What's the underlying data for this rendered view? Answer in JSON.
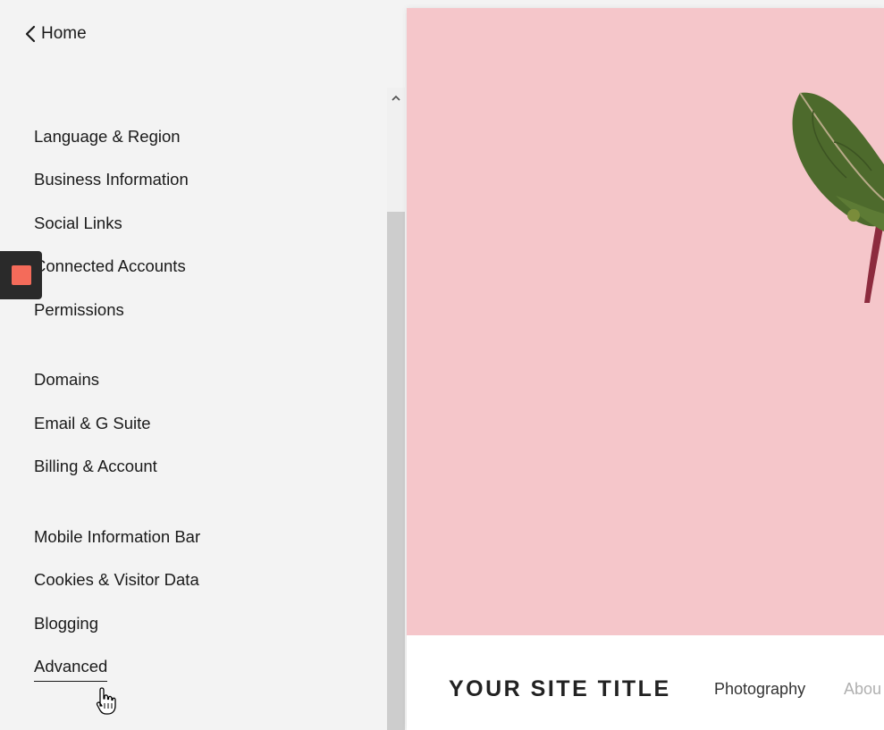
{
  "sidebar": {
    "home_label": "Home",
    "groups": [
      {
        "items": [
          {
            "label": "Language & Region"
          },
          {
            "label": "Business Information"
          },
          {
            "label": "Social Links"
          },
          {
            "label": "Connected Accounts"
          },
          {
            "label": "Permissions"
          }
        ]
      },
      {
        "items": [
          {
            "label": "Domains"
          },
          {
            "label": "Email & G Suite"
          },
          {
            "label": "Billing & Account"
          }
        ]
      },
      {
        "items": [
          {
            "label": "Mobile Information Bar"
          },
          {
            "label": "Cookies & Visitor Data"
          },
          {
            "label": "Blogging"
          },
          {
            "label": "Advanced"
          }
        ]
      }
    ],
    "hovered_item": "Advanced"
  },
  "badge": {
    "icon": "record-square-icon",
    "color": "#f46b5a"
  },
  "preview": {
    "hero_color": "#f5c6ca",
    "site_title": "YOUR SITE TITLE",
    "nav": [
      {
        "label": "Photography",
        "color": "#333333"
      },
      {
        "label": "Abou",
        "color": "#b0b0b0"
      }
    ]
  }
}
